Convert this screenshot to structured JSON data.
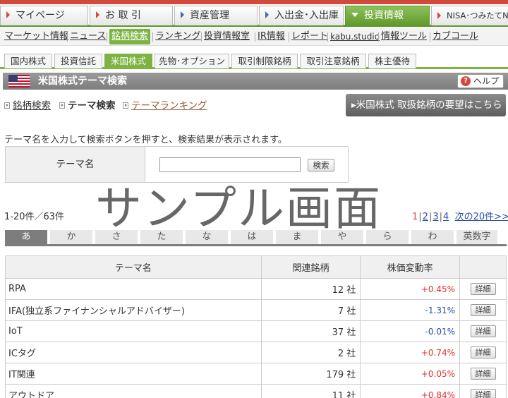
{
  "top_nav": [
    {
      "label": "マイページ",
      "state": "normal"
    },
    {
      "label": "お 取 引",
      "state": "normal"
    },
    {
      "label": "資産管理",
      "state": "normal"
    },
    {
      "label": "入出金･入出庫",
      "state": "normal"
    },
    {
      "label": "投資情報",
      "state": "active"
    },
    {
      "label": "NISA･つみたてNISA",
      "state": "normal"
    }
  ],
  "sub_nav": [
    "マーケット情報",
    "ニュース",
    "銘柄検索",
    "ランキング",
    "投資情報室",
    "IR情報",
    "レポート",
    "kabu.studio",
    "情報ツール",
    "カブコール"
  ],
  "sub_nav_active": "銘柄検索",
  "market_tabs": [
    "国内株式",
    "投資信託",
    "米国株式",
    "先物･オプション",
    "取引制限銘柄",
    "取引注意銘柄",
    "株主優待"
  ],
  "market_tab_active": "米国株式",
  "title_bar": {
    "title": "米国株式テーマ検索",
    "help_label": "ヘルプ",
    "flag": "us-flag-icon"
  },
  "breadcrumb": {
    "stock_search": "銘柄検索",
    "theme_search": "テーマ検索",
    "theme_ranking": "テーマランキング"
  },
  "request_button": "米国株式 取扱銘柄の要望はこちら",
  "description": "テーマ名を入力して検索ボタンを押すと、検索結果が表示されます。",
  "search": {
    "label": "テーマ名",
    "value": "",
    "placeholder": "",
    "button": "検索"
  },
  "watermark": "サンプル画面",
  "result_count": "1-20件／63件",
  "pager": {
    "current": "1",
    "pages": [
      "2",
      "3",
      "4"
    ],
    "next": "次の20件>>"
  },
  "kana_tabs": [
    "あ",
    "か",
    "さ",
    "た",
    "な",
    "は",
    "ま",
    "や",
    "ら",
    "わ",
    "英数字"
  ],
  "kana_active": "あ",
  "table": {
    "headers": [
      "テーマ名",
      "関連銘柄",
      "株価変動率",
      ""
    ],
    "rows": [
      {
        "name": "RPA",
        "count": "12 社",
        "change": "+0.45%",
        "dir": "up",
        "detail": "詳細"
      },
      {
        "name": "IFA(独立系ファイナンシャルアドバイザー)",
        "count": "7 社",
        "change": "-1.31%",
        "dir": "down",
        "detail": "詳細"
      },
      {
        "name": "IoT",
        "count": "37 社",
        "change": "-0.01%",
        "dir": "down",
        "detail": "詳細"
      },
      {
        "name": "ICタグ",
        "count": "2 社",
        "change": "+0.74%",
        "dir": "up",
        "detail": "詳細"
      },
      {
        "name": "IT関連",
        "count": "179 社",
        "change": "+0.05%",
        "dir": "up",
        "detail": "詳細"
      },
      {
        "name": "アウトドア",
        "count": "11 社",
        "change": "+0.84%",
        "dir": "up",
        "detail": "詳細"
      }
    ]
  },
  "colors": {
    "brand_green": "#7cb342",
    "accent_red": "#d24a3c",
    "up": "#e0312d",
    "down": "#2a4fa8"
  }
}
